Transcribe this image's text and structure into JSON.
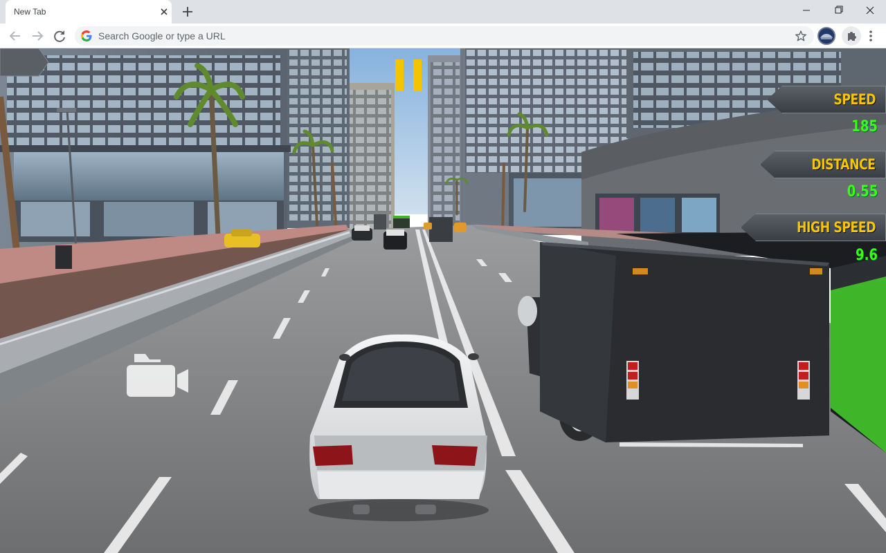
{
  "browser": {
    "tab_title": "New Tab",
    "omnibox_placeholder": "Search Google or type a URL",
    "icons": [
      "close-icon",
      "plus-icon",
      "minimize-icon",
      "maximize-icon",
      "window-close-icon",
      "back-arrow-icon",
      "forward-arrow-icon",
      "reload-icon",
      "google-icon",
      "star-icon",
      "puzzle-icon",
      "kebab-menu-icon"
    ]
  },
  "game": {
    "hud": {
      "speed_label": "SPEED",
      "speed_value": "185",
      "distance_label": "DISTANCE",
      "distance_value": "0.55",
      "high_speed_label": "HIGH SPEED",
      "high_speed_value": "9.6"
    },
    "colors": {
      "label_yellow": "#f6c700",
      "value_green": "#39ff14",
      "pause_yellow": "#f5c400",
      "sky": "#9cc4ea",
      "road": "#7f8081",
      "truck_body": "#303236",
      "bus_green": "#3fb52a"
    },
    "icons": [
      "pause-icon",
      "camera-icon",
      "back-arrow-icon"
    ]
  }
}
